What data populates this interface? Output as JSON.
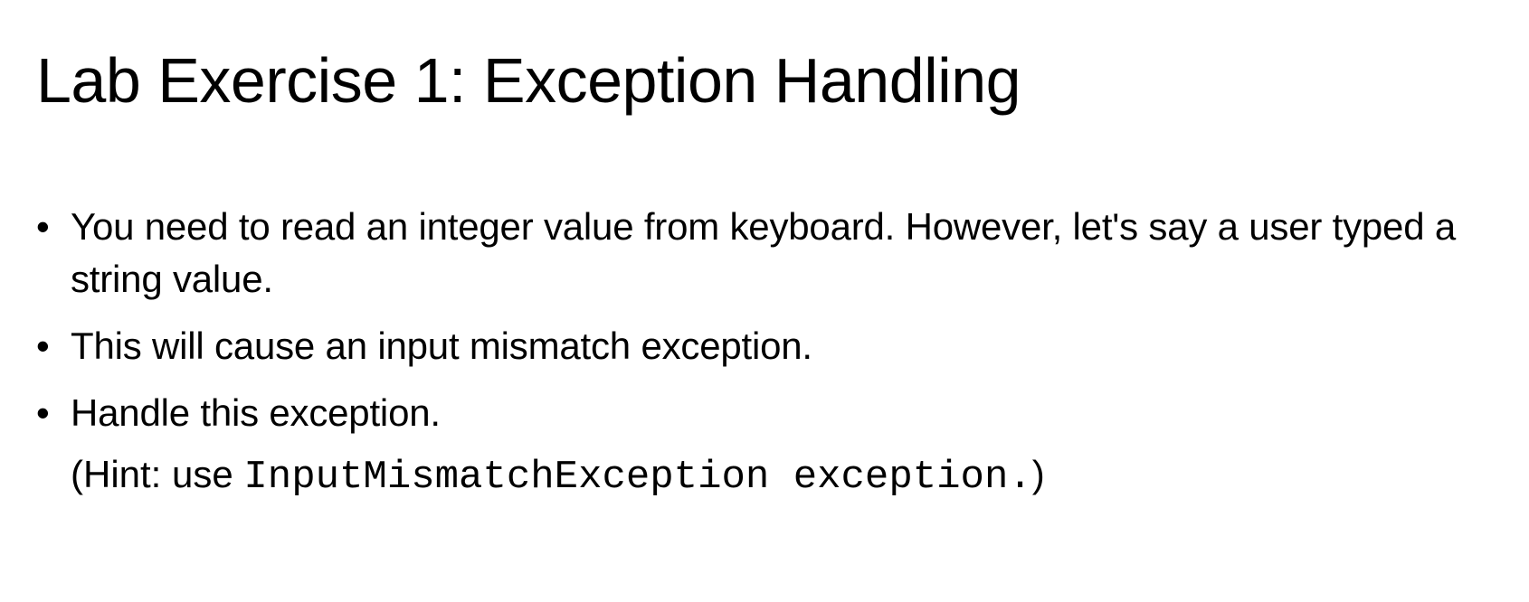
{
  "slide": {
    "title": "Lab Exercise 1: Exception Handling",
    "bullets": [
      "You need to read an integer value from keyboard. However, let's say a user typed a string value.",
      "This will cause an input mismatch exception.",
      "Handle this exception."
    ],
    "hint": {
      "prefix": "(Hint: use ",
      "code": "InputMismatchException exception.",
      "suffix": ")"
    },
    "bullet_glyph": "•"
  }
}
